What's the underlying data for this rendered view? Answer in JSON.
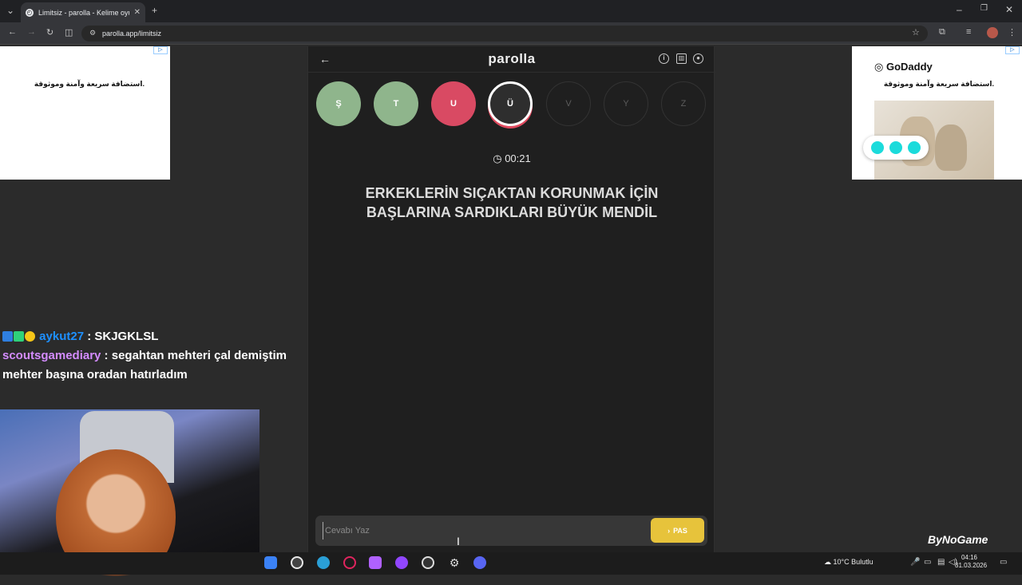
{
  "browser": {
    "tab_title": "Limitsiz - parolla - Kelime oyunu",
    "url": "parolla.app/limitsiz"
  },
  "ads": {
    "left_text": "استضافة سريعة وآمنة وموثوقة.",
    "right_brand": "GoDaddy",
    "right_text": "استضافة سريعة وآمنة وموثوقة."
  },
  "game": {
    "brand": "parolla",
    "letters": [
      {
        "char": "Ş",
        "state": "correct"
      },
      {
        "char": "T",
        "state": "correct"
      },
      {
        "char": "U",
        "state": "wrong"
      },
      {
        "char": "Ü",
        "state": "active"
      },
      {
        "char": "V",
        "state": "pending"
      },
      {
        "char": "Y",
        "state": "pending"
      },
      {
        "char": "Z",
        "state": "pending"
      }
    ],
    "timer": "00:21",
    "clue": "ERKEKLERİN SIÇAKTAN KORUNMAK İÇİN BAŞLARINA SARDIKLARI BÜYÜK MENDİL",
    "answer_placeholder": "Cevabı Yaz",
    "pass_label": "PAS"
  },
  "chat": {
    "messages": [
      {
        "user": "aykut27",
        "text": " : SKJGKLSL"
      },
      {
        "user": "scoutsgamediary",
        "text": " : segahtan mehteri çal demiştim mehter başına oradan hatırladım"
      }
    ]
  },
  "stream_watermark": "ByNoGame",
  "taskbar": {
    "weather": "10°C Bulutlu",
    "time": "04:16",
    "date": "31.03.2026"
  },
  "colors": {
    "correct": "#8fb58c",
    "wrong": "#d94a63",
    "pass_button": "#e7c33b"
  }
}
